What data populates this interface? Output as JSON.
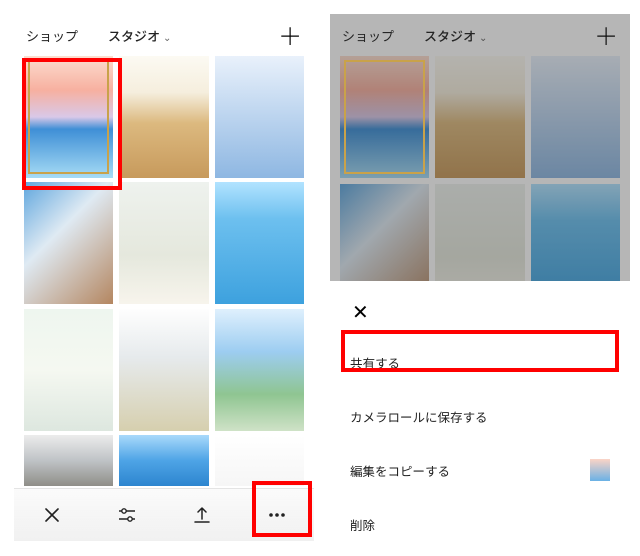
{
  "header": {
    "tab_shop": "ショップ",
    "tab_studio": "スタジオ",
    "studio_chevron": "⌄"
  },
  "sheet": {
    "close": "✕",
    "share": "共有する",
    "save_camera_roll": "カメラロールに保存する",
    "copy_edits": "編集をコピーする",
    "delete": "削除"
  },
  "icons": {
    "plus": "＋",
    "close_x": "✕",
    "adjust": "sliders-icon",
    "upload": "upload-icon",
    "more": "more-icon"
  }
}
